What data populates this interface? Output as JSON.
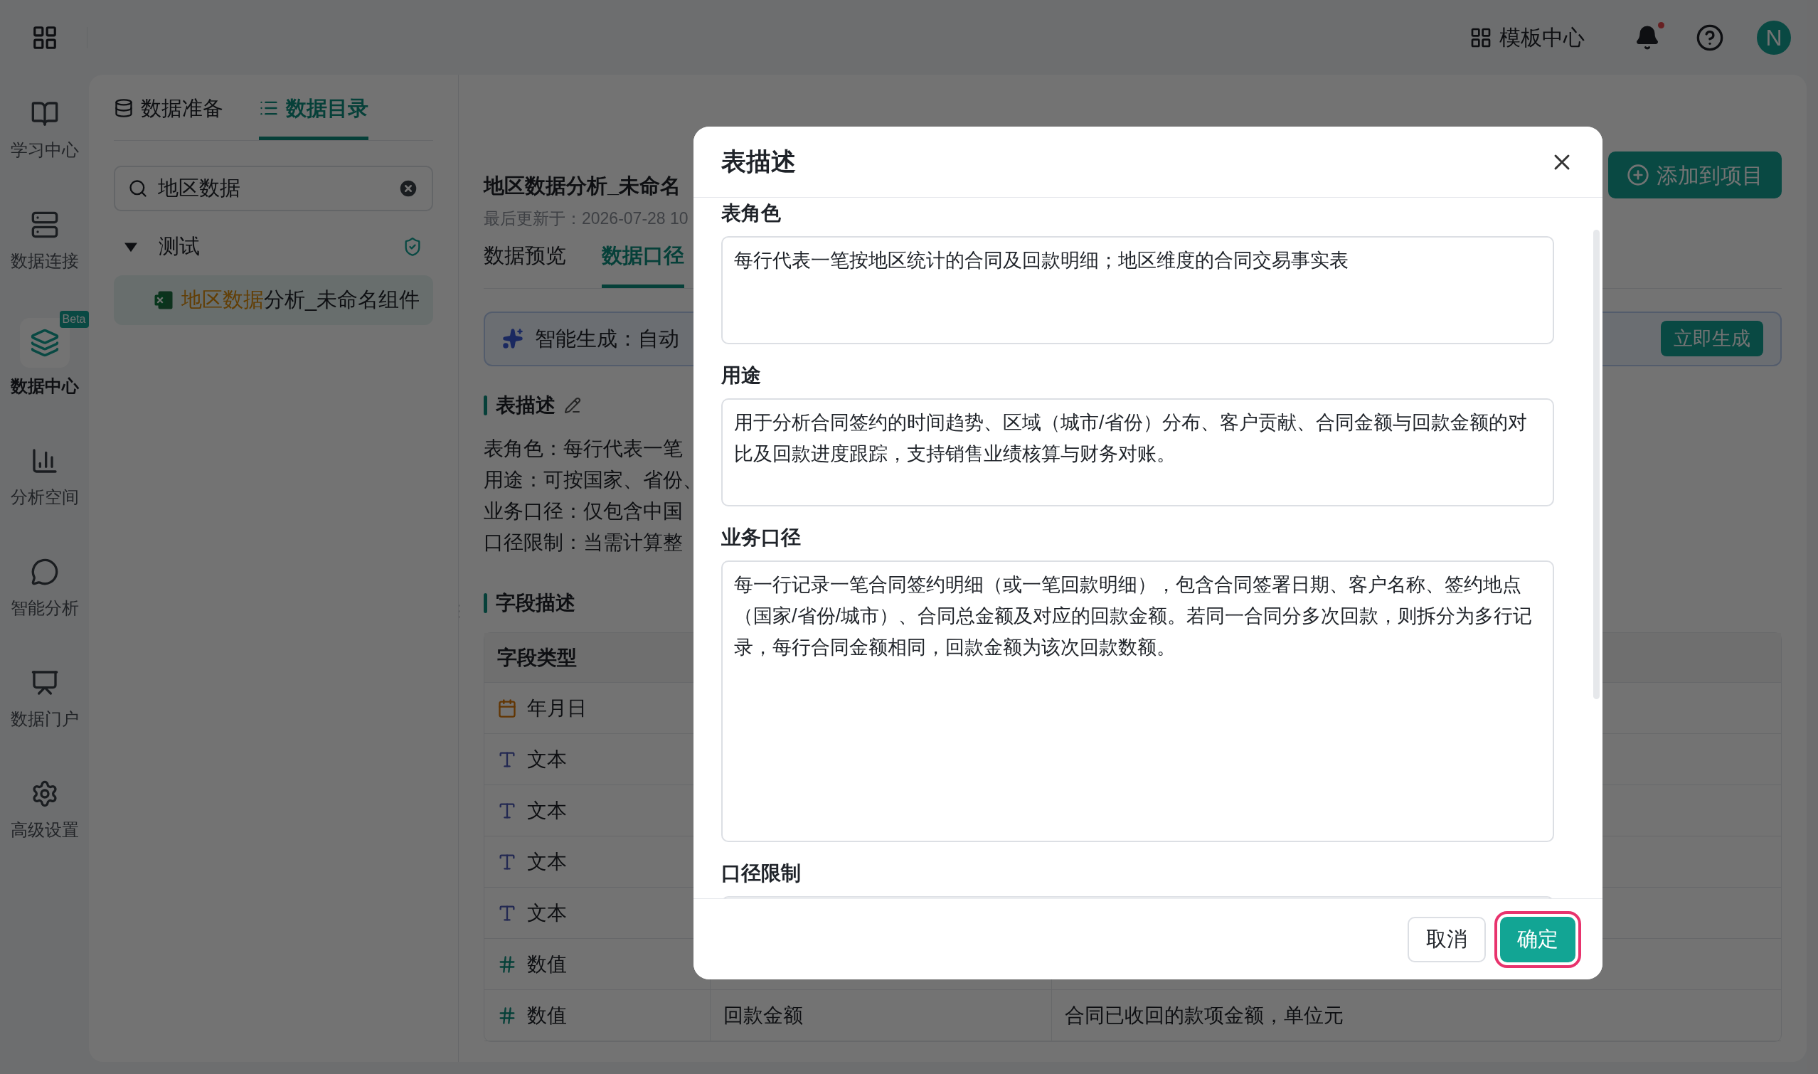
{
  "topbar": {
    "template_center": "模板中心",
    "avatar": "N"
  },
  "nav": [
    {
      "label": "学习中心",
      "selected": false
    },
    {
      "label": "数据连接",
      "selected": false
    },
    {
      "label": "数据中心",
      "selected": true,
      "badge": "Beta"
    },
    {
      "label": "分析空间",
      "selected": false
    },
    {
      "label": "智能分析",
      "selected": false
    },
    {
      "label": "数据门户",
      "selected": false
    },
    {
      "label": "高级设置",
      "selected": false
    }
  ],
  "left_panel": {
    "tabs": [
      {
        "label": "数据准备",
        "selected": false
      },
      {
        "label": "数据目录",
        "selected": true
      }
    ],
    "search": {
      "value": "地区数据"
    },
    "tree": [
      {
        "label": "测试",
        "expanded": true,
        "children": [
          {
            "match": "地区数据",
            "rest": "分析_未命名组件",
            "selected": true
          }
        ]
      }
    ]
  },
  "content": {
    "title": "地区数据分析_未命名",
    "updated": "最后更新于：2026-07-28 10",
    "add_button": "添加到项目",
    "tabs": [
      {
        "label": "数据预览",
        "selected": false
      },
      {
        "label": "数据口径",
        "selected": true
      }
    ],
    "ai_banner": {
      "text": "智能生成：自动",
      "button": "立即生成"
    },
    "table_description": {
      "title": "表描述",
      "lines": [
        "表角色：每行代表一笔",
        "用途：可按国家、省份、",
        "业务口径：仅包含中国",
        "口径限制：当需计算整"
      ]
    },
    "field_description": {
      "title": "字段描述",
      "column_1": "字段类型",
      "rows": [
        {
          "kind": "date",
          "type": "年月日"
        },
        {
          "kind": "text",
          "type": "文本"
        },
        {
          "kind": "text",
          "type": "文本"
        },
        {
          "kind": "text",
          "type": "文本"
        },
        {
          "kind": "text",
          "type": "文本"
        },
        {
          "kind": "number",
          "type": "数值"
        },
        {
          "kind": "number",
          "type": "数值",
          "name": "回款金额",
          "description": "合同已收回的款项金额，单位元"
        }
      ]
    }
  },
  "modal": {
    "title": "表描述",
    "fields": [
      {
        "label": "表角色",
        "value": "每行代表一笔按地区统计的合同及回款明细；地区维度的合同交易事实表",
        "kind": "short"
      },
      {
        "label": "用途",
        "value": "用于分析合同签约的时间趋势、区域（城市/省份）分布、客户贡献、合同金额与回款金额的对比及回款进度跟踪，支持销售业绩核算与财务对账。",
        "kind": "short"
      },
      {
        "label": "业务口径",
        "value": "每一行记录一笔合同签约明细（或一笔回款明细），包含合同签署日期、客户名称、签约地点（国家/省份/城市）、合同总金额及对应的回款金额。若同一合同分多次回款，则拆分为多行记录，每行合同金额相同，回款金额为该次回款数额。",
        "kind": "tall"
      },
      {
        "label": "口径限制",
        "kind": "short"
      }
    ],
    "cancel": "取消",
    "confirm": "确定",
    "confirm_focused": true
  }
}
